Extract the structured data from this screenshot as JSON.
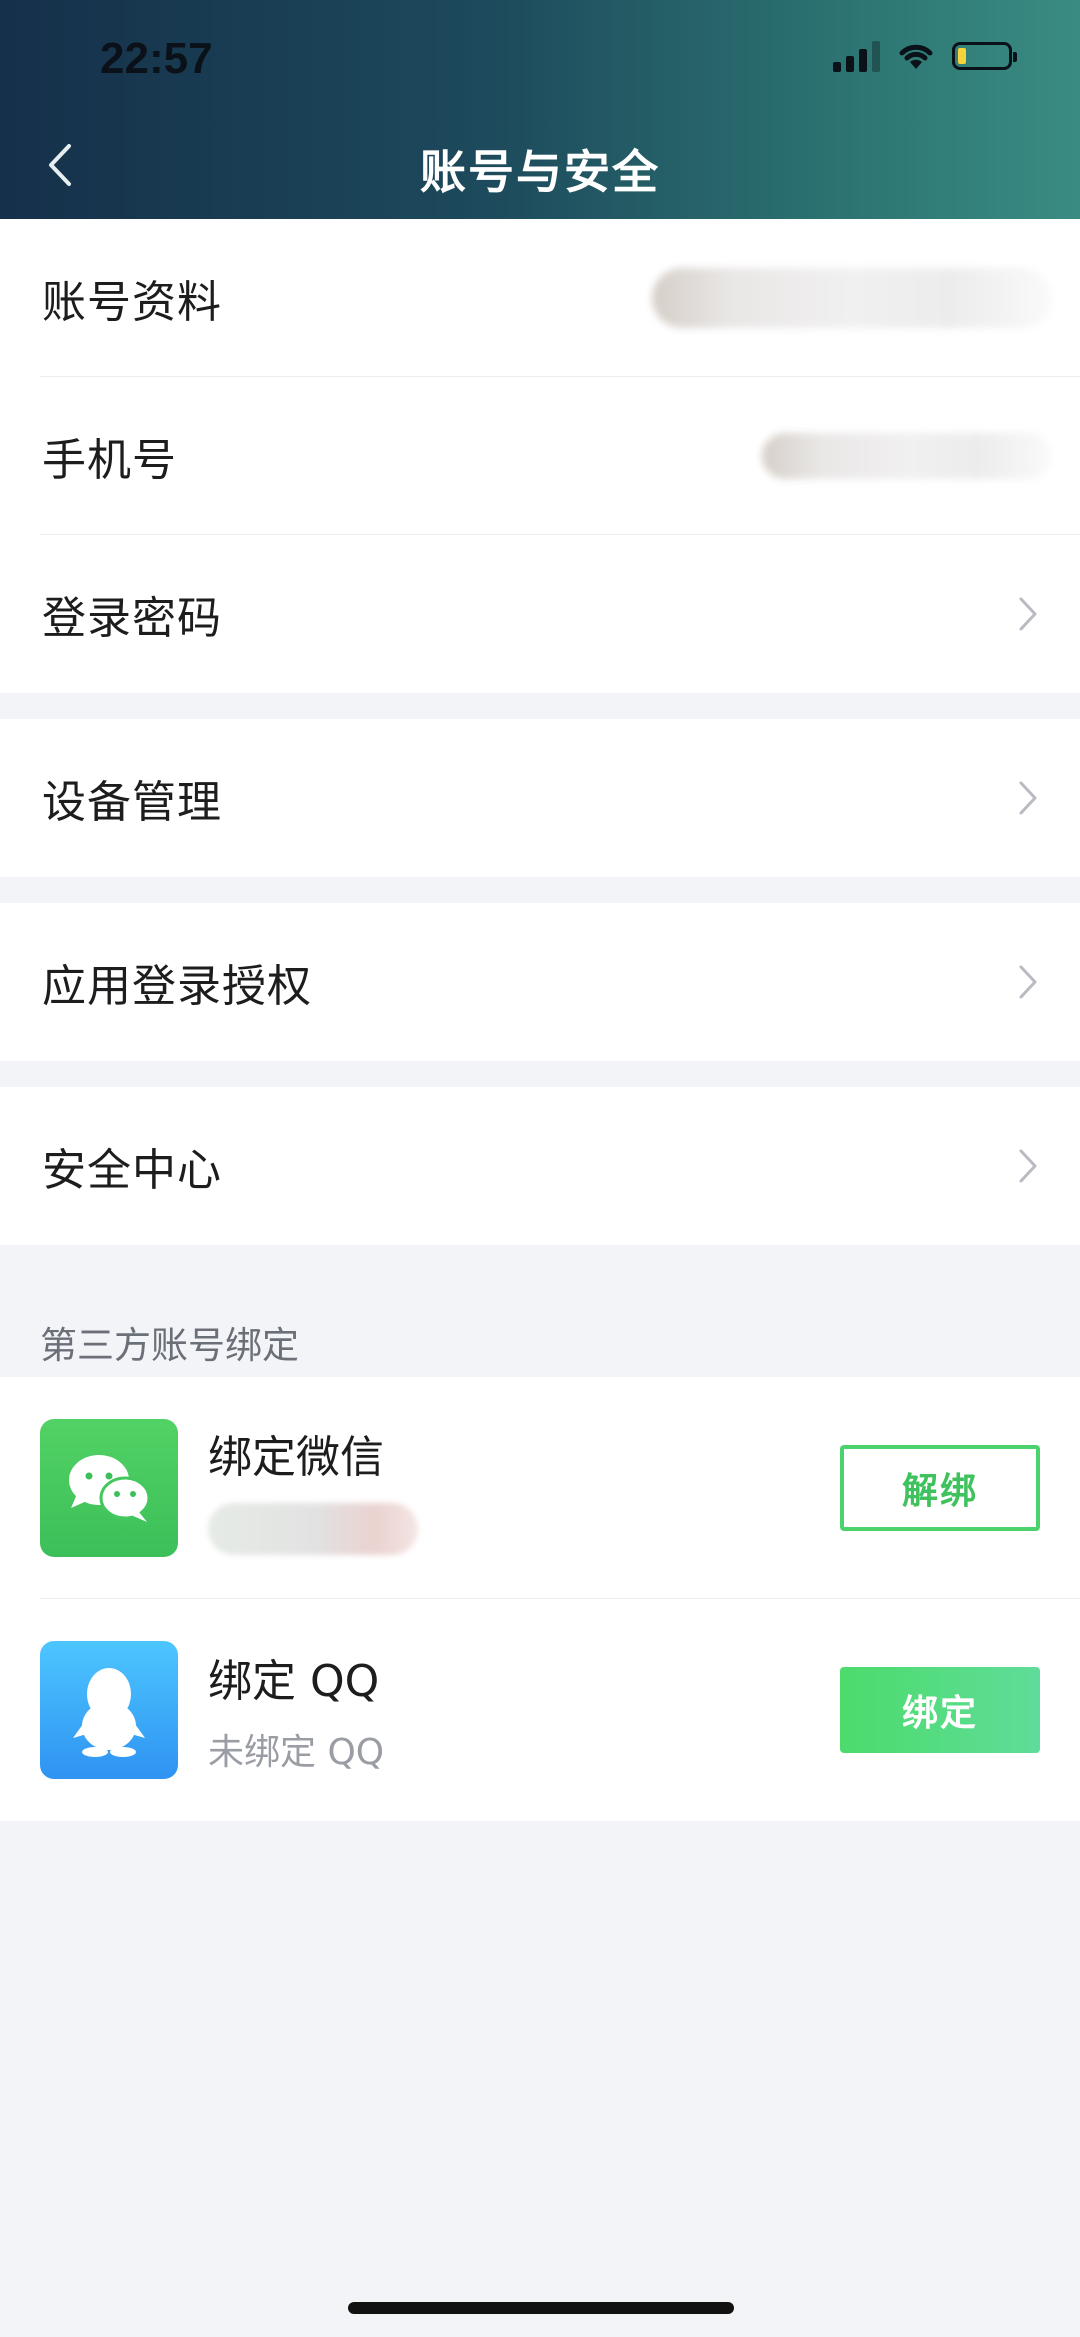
{
  "status_bar": {
    "time": "22:57",
    "signal_icon": "cellular-signal-icon",
    "wifi_icon": "wifi-icon",
    "battery_icon": "battery-low-icon",
    "battery_level": 0.15
  },
  "header": {
    "title": "账号与安全",
    "back_icon": "chevron-left-icon"
  },
  "menu": {
    "account_profile": "账号资料",
    "phone": "手机号",
    "login_password": "登录密码",
    "device_management": "设备管理",
    "app_login_authorization": "应用登录授权",
    "security_center": "安全中心"
  },
  "third_party": {
    "section_title": "第三方账号绑定",
    "wechat": {
      "title": "绑定微信",
      "icon": "wechat-icon",
      "button": "解绑"
    },
    "qq": {
      "title": "绑定 QQ",
      "subtitle": "未绑定 QQ",
      "icon": "qq-penguin-icon",
      "button": "绑定"
    }
  },
  "colors": {
    "accent_green": "#4cd26a",
    "header_start": "#15304a",
    "header_end": "#3a8c83",
    "background": "#f3f4f8"
  }
}
